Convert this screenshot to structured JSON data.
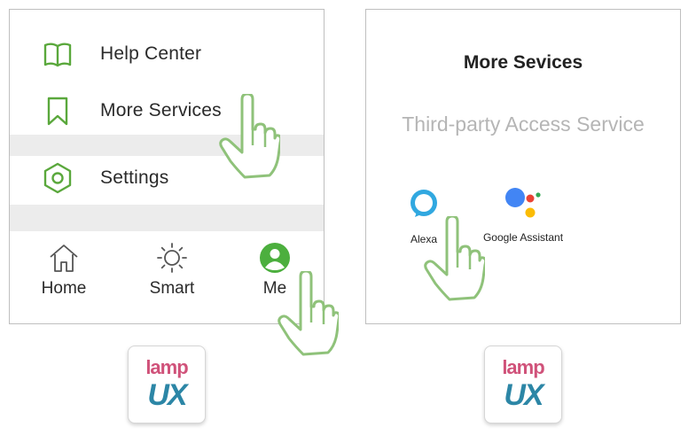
{
  "left_panel": {
    "menu": [
      {
        "label": "Help Center",
        "icon": "book-icon"
      },
      {
        "label": "More Services",
        "icon": "bookmark-icon"
      },
      {
        "label": "Settings",
        "icon": "hexagon-settings-icon"
      }
    ],
    "tabs": [
      {
        "label": "Home",
        "icon": "home-icon"
      },
      {
        "label": "Smart",
        "icon": "sun-icon"
      },
      {
        "label": "Me",
        "icon": "user-avatar-icon",
        "active": true
      }
    ]
  },
  "right_panel": {
    "title": "More Sevices",
    "subtitle": "Third-party Access Service",
    "services": [
      {
        "label": "Alexa",
        "icon": "alexa-icon"
      },
      {
        "label": "Google Assistant",
        "icon": "google-assistant-icon"
      }
    ]
  },
  "logos": [
    {
      "line1": "lamp",
      "line2": "UX"
    },
    {
      "line1": "lamp",
      "line2": "UX"
    }
  ],
  "colors": {
    "accent_green": "#5aa83c",
    "hand_outline": "#8fc27a",
    "band_gray": "#ececec",
    "subtitle_gray": "#b5b5b5",
    "logo_pink": "#d0527a",
    "logo_teal": "#2c86a6"
  }
}
